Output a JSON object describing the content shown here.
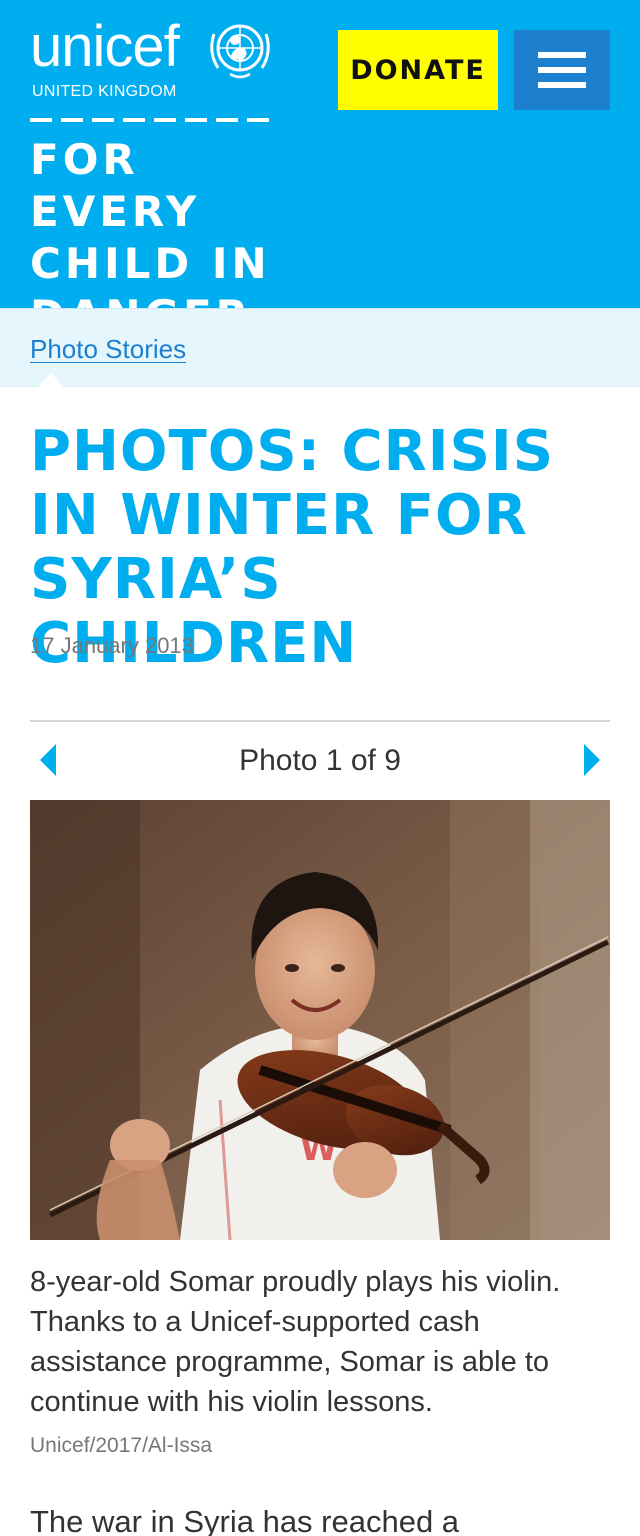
{
  "header": {
    "logo_text": "unicef",
    "logo_subtitle": "UNITED KINGDOM",
    "tagline_lines": [
      "FOR EVERY",
      "CHILD IN",
      "DANGER"
    ],
    "donate_label": "DONATE",
    "menu_icon": "hamburger-menu-icon"
  },
  "breadcrumb": {
    "label": "Photo Stories"
  },
  "article": {
    "title": "PHOTOS: CRISIS IN WINTER FOR SYRIA’S CHILDREN",
    "date": "17 January 2013"
  },
  "gallery": {
    "counter": "Photo 1 of 9",
    "prev_icon": "chevron-left-icon",
    "next_icon": "chevron-right-icon",
    "caption": "8-year-old Somar proudly plays his violin. Thanks to a Unicef-supported cash assistance programme, Somar is able to continue with his violin lessons.",
    "credit": "Unicef/2017/Al-Issa"
  },
  "body": {
    "intro": "The war in Syria has reached a"
  },
  "colors": {
    "brand_blue": "#00aeef",
    "donate_yellow": "#ffff00",
    "menu_blue": "#1c80cf",
    "breadcrumb_bg": "#e5f6fd"
  }
}
